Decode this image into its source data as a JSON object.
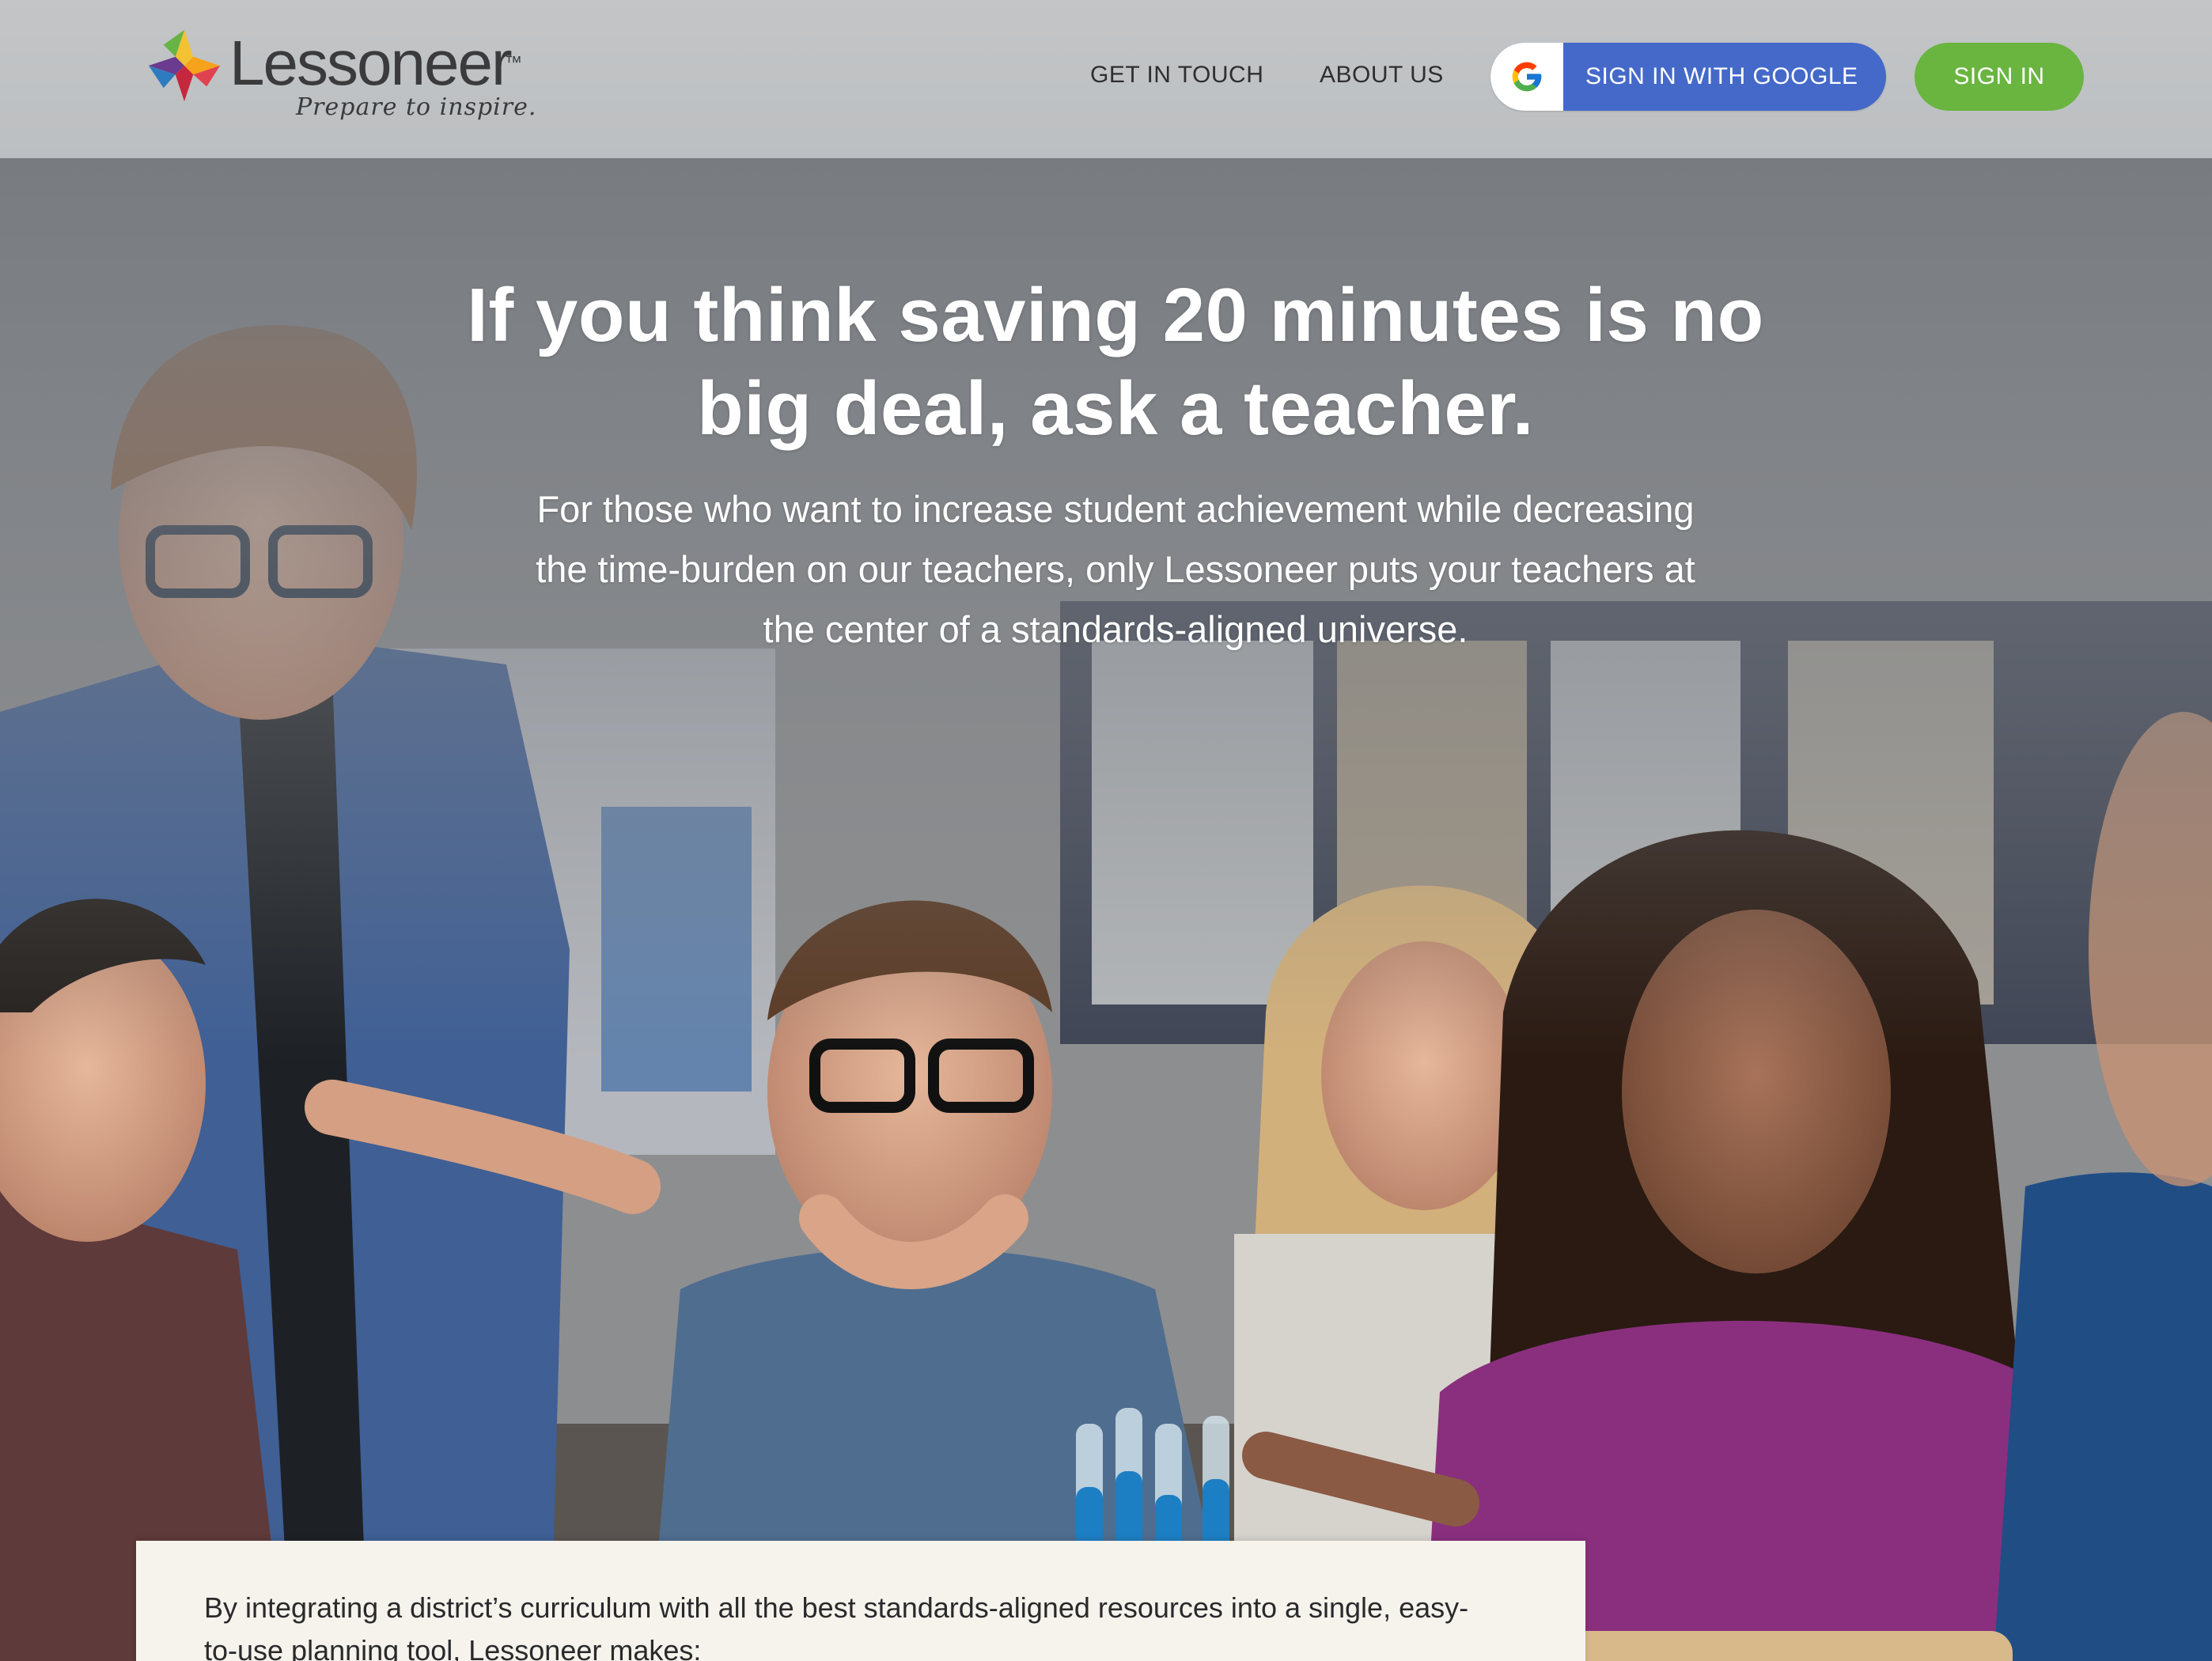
{
  "brand": {
    "name": "Lessoneer",
    "trademark": "™",
    "tagline": "Prepare to inspire."
  },
  "nav": {
    "get_in_touch": "GET IN TOUCH",
    "about_us": "ABOUT US",
    "google_signin": "SIGN IN WITH GOOGLE",
    "signin": "SIGN IN"
  },
  "hero": {
    "title": "If you think saving 20 minutes is no big deal, ask a teacher.",
    "subtitle": "For those who want to increase student achievement while decreasing the time-burden on our teachers, only Lessoneer puts your teachers at the center of a standards-aligned universe."
  },
  "intro": {
    "text": "By integrating a district’s curriculum with all the best standards-aligned resources into a single, easy-to-use planning tool, Lessoneer makes:"
  },
  "colors": {
    "header_bg": "#c0c2c4",
    "google_blue": "#4469c9",
    "signin_green": "#69b540",
    "card_bg": "#f6f3ed"
  },
  "icons": {
    "logo": "lessoneer-star-logo",
    "google": "google-g-icon"
  }
}
